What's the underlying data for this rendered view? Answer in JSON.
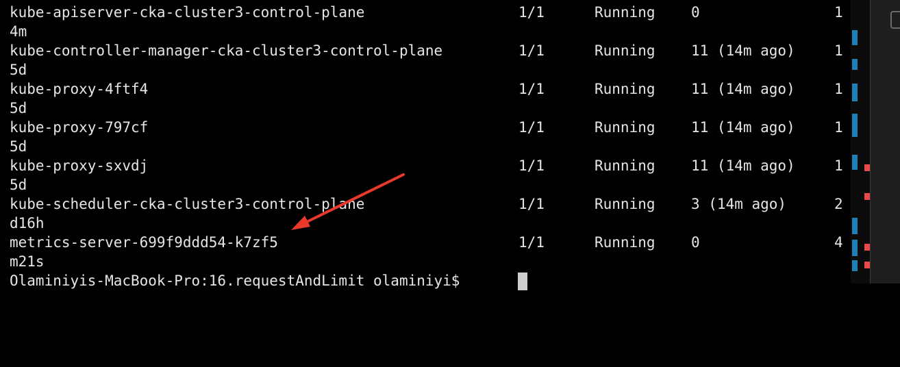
{
  "pods": [
    {
      "name": "kube-apiserver-cka-cluster3-control-plane",
      "ready": "1/1",
      "status": "Running",
      "restarts": "0",
      "age_head": "1",
      "age_tail": "4m"
    },
    {
      "name": "kube-controller-manager-cka-cluster3-control-plane",
      "ready": "1/1",
      "status": "Running",
      "restarts": "11 (14m ago)",
      "age_head": "1",
      "age_tail": "5d"
    },
    {
      "name": "kube-proxy-4ftf4",
      "ready": "1/1",
      "status": "Running",
      "restarts": "11 (14m ago)",
      "age_head": "1",
      "age_tail": "5d"
    },
    {
      "name": "kube-proxy-797cf",
      "ready": "1/1",
      "status": "Running",
      "restarts": "11 (14m ago)",
      "age_head": "1",
      "age_tail": "5d"
    },
    {
      "name": "kube-proxy-sxvdj",
      "ready": "1/1",
      "status": "Running",
      "restarts": "11 (14m ago)",
      "age_head": "1",
      "age_tail": "5d"
    },
    {
      "name": "kube-scheduler-cka-cluster3-control-plane",
      "ready": "1/1",
      "status": "Running",
      "restarts": "3 (14m ago)",
      "age_head": "2",
      "age_tail": "d16h"
    },
    {
      "name": "metrics-server-699f9ddd54-k7zf5",
      "ready": "1/1",
      "status": "Running",
      "restarts": "0",
      "age_head": "4",
      "age_tail": "m21s"
    }
  ],
  "prompt": "Olaminiyis-MacBook-Pro:16.requestAndLimit olaminiyi$ ",
  "annotation": {
    "icon": "red-arrow-icon",
    "color": "#e8392a",
    "target_row": "metrics-server-699f9ddd54-k7zf5"
  },
  "ruler": {
    "change_color": "#1f7fb6",
    "error_color": "#e84a4a"
  }
}
